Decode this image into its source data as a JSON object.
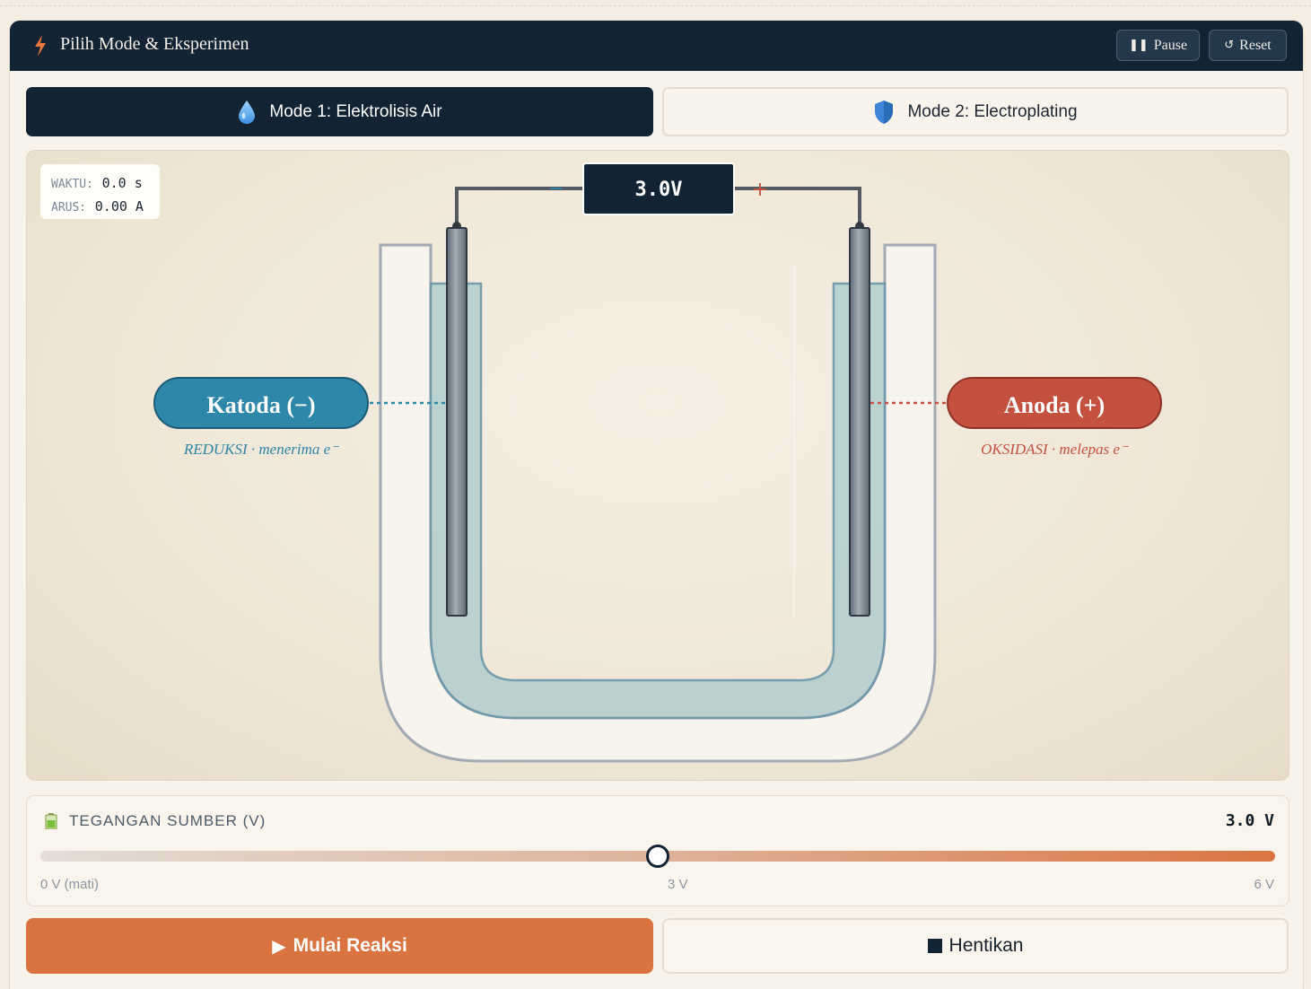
{
  "header": {
    "title": "Pilih Mode & Eksperimen",
    "pause_label": "Pause",
    "reset_label": "Reset"
  },
  "modes": [
    {
      "label": "Mode 1: Elektrolisis Air",
      "icon": "water-drop-icon",
      "active": true
    },
    {
      "label": "Mode 2: Electroplating",
      "icon": "shield-icon",
      "active": false
    }
  ],
  "readout": {
    "time_label": "WAKTU:",
    "time_value": "0.0 s",
    "current_label": "ARUS:",
    "current_value": "0.00 A"
  },
  "cell": {
    "voltage_display": "3.0V",
    "minus_sign": "−",
    "plus_sign": "+",
    "cathode_label": "Katoda (−)",
    "cathode_desc": "REDUKSI · menerima e⁻",
    "anode_label": "Anoda (+)",
    "anode_desc": "OKSIDASI · melepas e⁻"
  },
  "voltage": {
    "label": "TEGANGAN SUMBER (V)",
    "value_text": "3.0 V",
    "value": 3.0,
    "min": 0,
    "max": 6,
    "tick_min": "0 V (mati)",
    "tick_mid": "3 V",
    "tick_max": "6 V"
  },
  "actions": {
    "start_label": "Mulai Reaksi",
    "stop_label": "Hentikan"
  },
  "colors": {
    "navy": "#122333",
    "accent": "#d97440",
    "cathode": "#2e86a8",
    "anode": "#c4513f"
  }
}
